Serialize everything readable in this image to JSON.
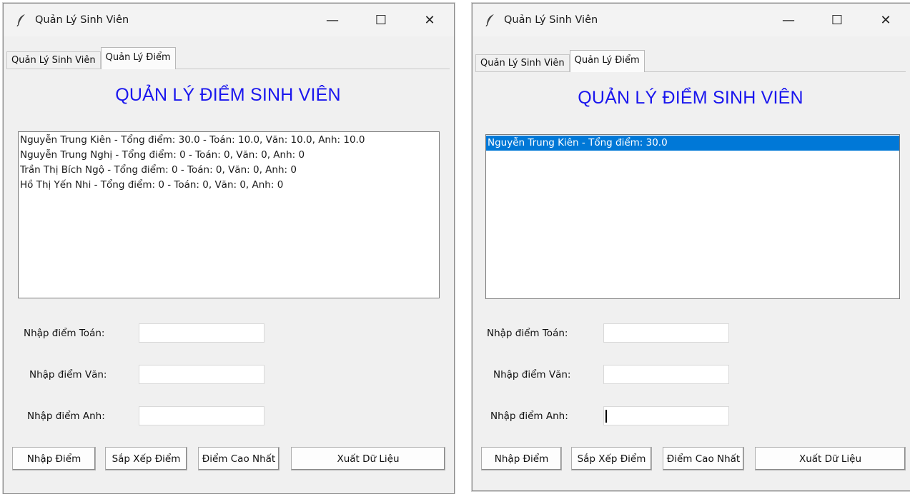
{
  "window_title": "Quản Lý Sinh Viên",
  "controls": {
    "minimize": "—",
    "maximize": "☐",
    "close": "✕"
  },
  "tabs": [
    "Quản Lý Sinh Viên",
    "Quản Lý Điểm"
  ],
  "heading": "QUẢN LÝ ĐIỂM SINH VIÊN",
  "labels": {
    "math": "Nhập điểm Toán:",
    "literature": "Nhập điểm Văn:",
    "english": "Nhập điểm Anh:"
  },
  "buttons": {
    "enter": "Nhập Điểm",
    "sort": "Sắp Xếp Điểm",
    "highest": "Điểm Cao Nhất",
    "export": "Xuất Dữ Liệu"
  },
  "left_window": {
    "list": [
      "Nguyễn Trung Kiên - Tổng điểm: 30.0 - Toán: 10.0, Văn: 10.0, Anh: 10.0",
      "Nguyễn Trung Nghị  - Tổng điểm: 0 - Toán: 0, Văn: 0, Anh: 0",
      "Trần Thị Bích Ngộ  - Tổng điểm: 0 - Toán: 0, Văn: 0, Anh: 0",
      "Hồ Thị Yến Nhi - Tổng điểm: 0 - Toán: 0, Văn: 0, Anh: 0"
    ],
    "inputs": {
      "math": "",
      "literature": "",
      "english": ""
    }
  },
  "right_window": {
    "list": [
      "Nguyễn Trung Kiên - Tổng điểm: 30.0"
    ],
    "selected_index": 0,
    "inputs": {
      "math": "",
      "literature": "",
      "english": ""
    }
  },
  "colors": {
    "heading": "#1a16ee",
    "selection": "#0078d7"
  }
}
